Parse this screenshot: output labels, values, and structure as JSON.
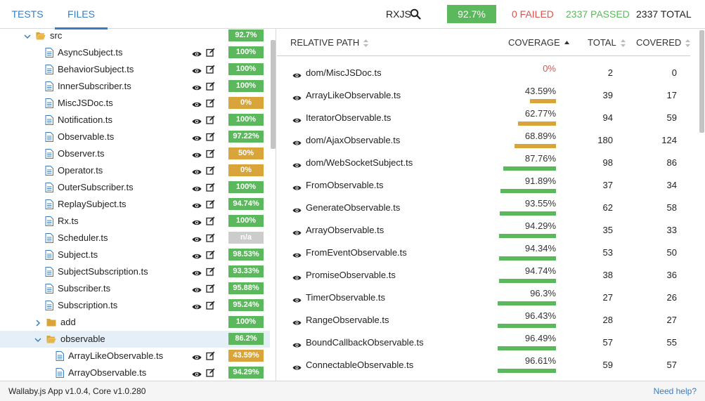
{
  "header": {
    "tabs": [
      {
        "label": "TESTS"
      },
      {
        "label": "FILES"
      }
    ],
    "project": "RXJS",
    "coverage": "92.7%",
    "failed": "0 FAILED",
    "passed": "2337 PASSED",
    "total": "2337 TOTAL"
  },
  "colors": {
    "accent": "#3a7cc0",
    "green": "#5cb85c",
    "orange": "#d9a43a",
    "red": "#d9534f",
    "gray": "#cccccc"
  },
  "tree": [
    {
      "type": "folder",
      "open": true,
      "label": "src",
      "pct": "92.7%",
      "level": "green"
    },
    {
      "type": "file",
      "label": "AsyncSubject.ts",
      "pct": "100%",
      "level": "green"
    },
    {
      "type": "file",
      "label": "BehaviorSubject.ts",
      "pct": "100%",
      "level": "green"
    },
    {
      "type": "file",
      "label": "InnerSubscriber.ts",
      "pct": "100%",
      "level": "green"
    },
    {
      "type": "file",
      "label": "MiscJSDoc.ts",
      "pct": "0%",
      "level": "orange"
    },
    {
      "type": "file",
      "label": "Notification.ts",
      "pct": "100%",
      "level": "green"
    },
    {
      "type": "file",
      "label": "Observable.ts",
      "pct": "97.22%",
      "level": "green"
    },
    {
      "type": "file",
      "label": "Observer.ts",
      "pct": "50%",
      "level": "orange"
    },
    {
      "type": "file",
      "label": "Operator.ts",
      "pct": "0%",
      "level": "orange"
    },
    {
      "type": "file",
      "label": "OuterSubscriber.ts",
      "pct": "100%",
      "level": "green"
    },
    {
      "type": "file",
      "label": "ReplaySubject.ts",
      "pct": "94.74%",
      "level": "green"
    },
    {
      "type": "file",
      "label": "Rx.ts",
      "pct": "100%",
      "level": "green"
    },
    {
      "type": "file",
      "label": "Scheduler.ts",
      "pct": "n/a",
      "level": "gray"
    },
    {
      "type": "file",
      "label": "Subject.ts",
      "pct": "98.53%",
      "level": "green"
    },
    {
      "type": "file",
      "label": "SubjectSubscription.ts",
      "pct": "93.33%",
      "level": "green"
    },
    {
      "type": "file",
      "label": "Subscriber.ts",
      "pct": "95.88%",
      "level": "green"
    },
    {
      "type": "file",
      "label": "Subscription.ts",
      "pct": "95.24%",
      "level": "green"
    },
    {
      "type": "folder",
      "open": false,
      "label": "add",
      "pct": "100%",
      "level": "green"
    },
    {
      "type": "folder",
      "open": true,
      "selected": true,
      "label": "observable",
      "pct": "86.2%",
      "level": "green"
    },
    {
      "type": "file",
      "nested": true,
      "label": "ArrayLikeObservable.ts",
      "pct": "43.59%",
      "level": "orange"
    },
    {
      "type": "file",
      "nested": true,
      "label": "ArrayObservable.ts",
      "pct": "94.29%",
      "level": "green"
    }
  ],
  "table": {
    "headers": {
      "path": "RELATIVE PATH",
      "coverage": "COVERAGE",
      "total": "TOTAL",
      "covered": "COVERED"
    },
    "rows": [
      {
        "path": "dom/MiscJSDoc.ts",
        "coverage": "0%",
        "pct": 0,
        "total": "2",
        "covered": "0"
      },
      {
        "path": "ArrayLikeObservable.ts",
        "coverage": "43.59%",
        "pct": 43.59,
        "total": "39",
        "covered": "17"
      },
      {
        "path": "IteratorObservable.ts",
        "coverage": "62.77%",
        "pct": 62.77,
        "total": "94",
        "covered": "59"
      },
      {
        "path": "dom/AjaxObservable.ts",
        "coverage": "68.89%",
        "pct": 68.89,
        "total": "180",
        "covered": "124"
      },
      {
        "path": "dom/WebSocketSubject.ts",
        "coverage": "87.76%",
        "pct": 87.76,
        "total": "98",
        "covered": "86"
      },
      {
        "path": "FromObservable.ts",
        "coverage": "91.89%",
        "pct": 91.89,
        "total": "37",
        "covered": "34"
      },
      {
        "path": "GenerateObservable.ts",
        "coverage": "93.55%",
        "pct": 93.55,
        "total": "62",
        "covered": "58"
      },
      {
        "path": "ArrayObservable.ts",
        "coverage": "94.29%",
        "pct": 94.29,
        "total": "35",
        "covered": "33"
      },
      {
        "path": "FromEventObservable.ts",
        "coverage": "94.34%",
        "pct": 94.34,
        "total": "53",
        "covered": "50"
      },
      {
        "path": "PromiseObservable.ts",
        "coverage": "94.74%",
        "pct": 94.74,
        "total": "38",
        "covered": "36"
      },
      {
        "path": "TimerObservable.ts",
        "coverage": "96.3%",
        "pct": 96.3,
        "total": "27",
        "covered": "26"
      },
      {
        "path": "RangeObservable.ts",
        "coverage": "96.43%",
        "pct": 96.43,
        "total": "28",
        "covered": "27"
      },
      {
        "path": "BoundCallbackObservable.ts",
        "coverage": "96.49%",
        "pct": 96.49,
        "total": "57",
        "covered": "55"
      },
      {
        "path": "ConnectableObservable.ts",
        "coverage": "96.61%",
        "pct": 96.61,
        "total": "59",
        "covered": "57"
      }
    ]
  },
  "footer": {
    "version": "Wallaby.js App v1.0.4, Core v1.0.280",
    "help": "Need help?"
  }
}
